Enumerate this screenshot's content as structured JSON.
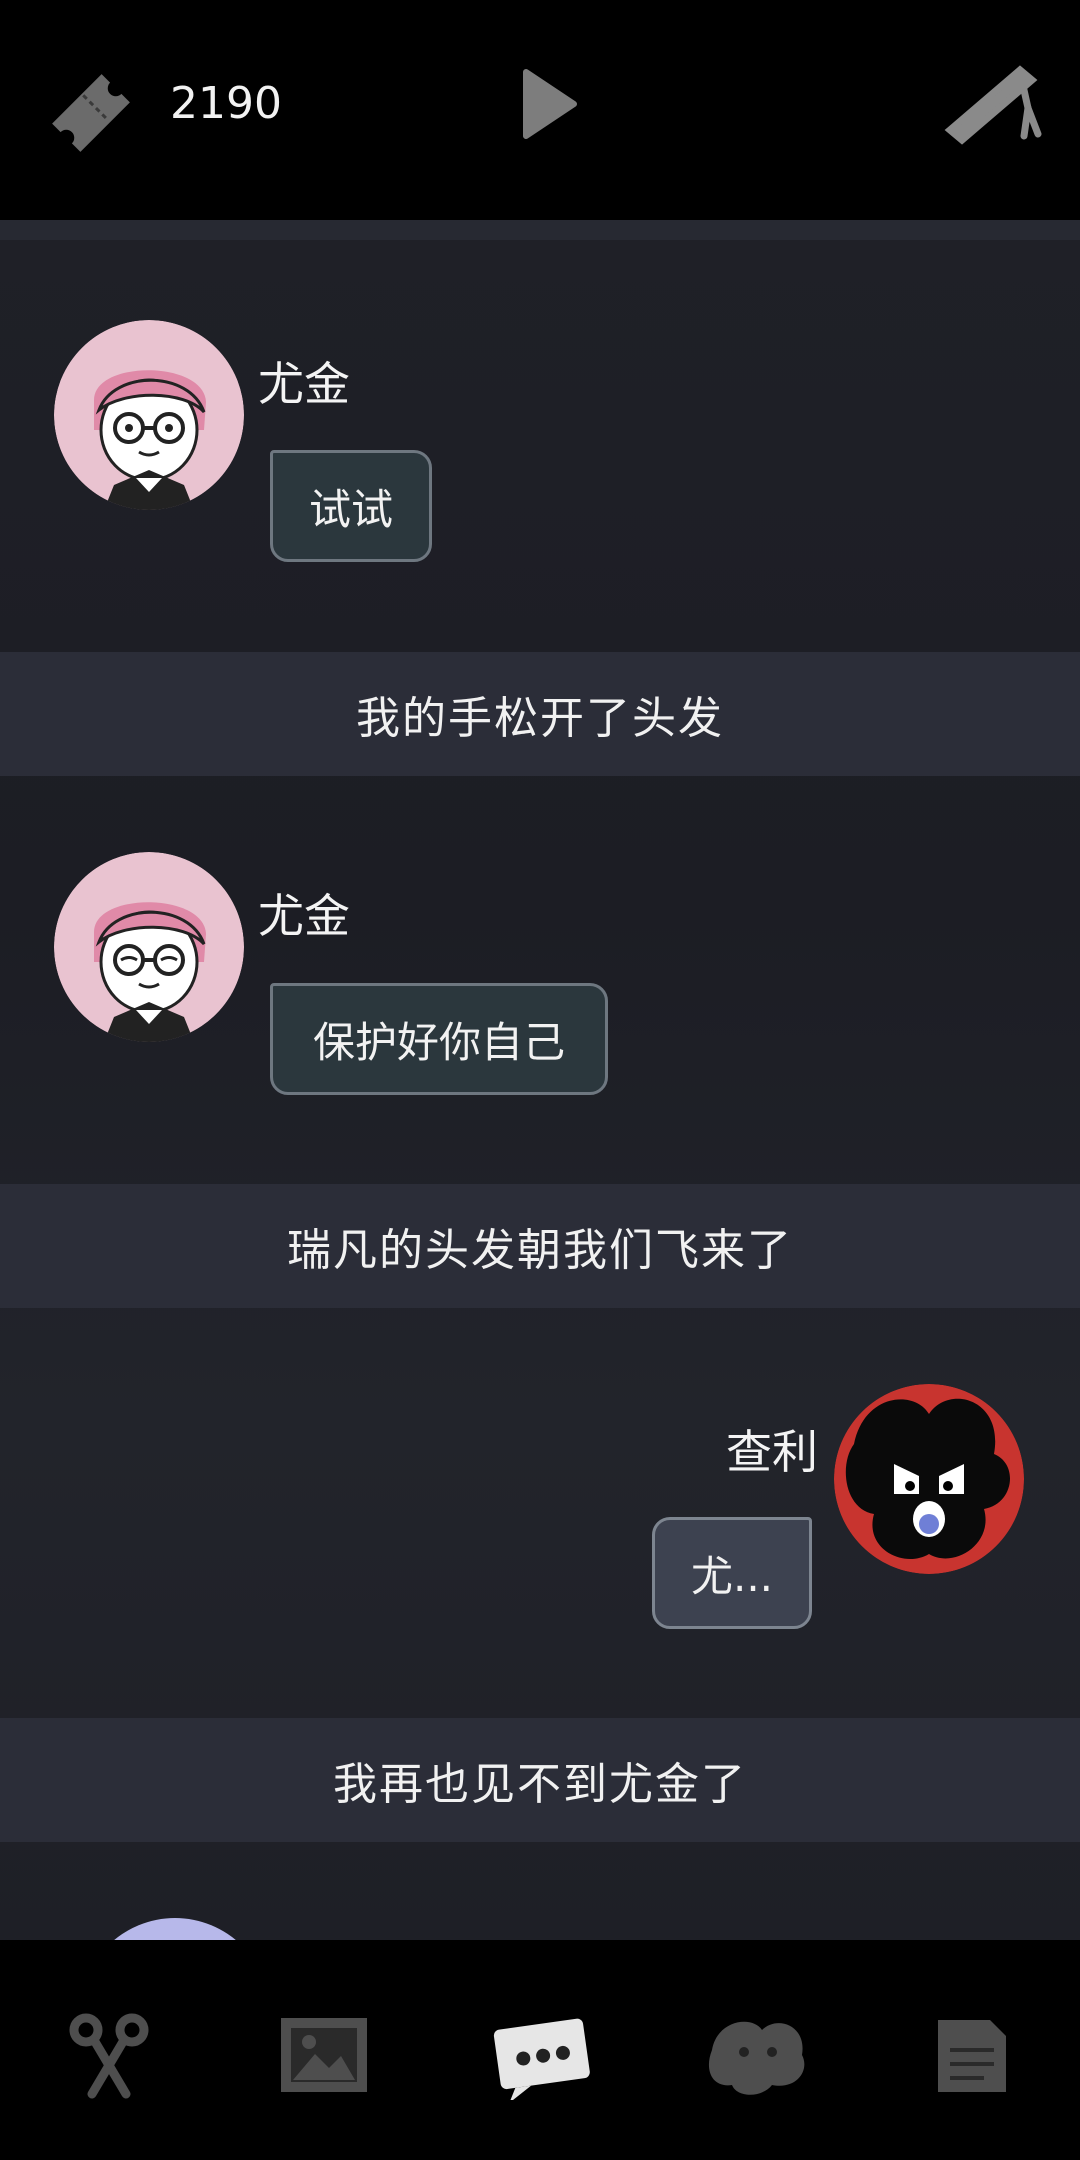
{
  "header": {
    "ticket_icon": "ticket-icon",
    "ticket_count": "2190",
    "play_icon": "play-icon",
    "edit_icon": "pen-icon"
  },
  "messages": [
    {
      "type": "chat",
      "speaker": "尤金",
      "side": "left",
      "text": "试试",
      "avatar": "eugene-avatar"
    },
    {
      "type": "narration",
      "text": "我的手松开了头发"
    },
    {
      "type": "chat",
      "speaker": "尤金",
      "side": "left",
      "text": "保护好你自己",
      "avatar": "eugene-avatar-eyes-closed"
    },
    {
      "type": "narration",
      "text": "瑞凡的头发朝我们飞来了"
    },
    {
      "type": "chat",
      "speaker": "查利",
      "side": "right",
      "text": "尤...",
      "avatar": "charlie-avatar"
    },
    {
      "type": "narration",
      "text": "我再也见不到尤金了"
    }
  ],
  "bottom_nav": [
    {
      "icon": "scissors-icon",
      "active": false
    },
    {
      "icon": "photo-icon",
      "active": false
    },
    {
      "icon": "chat-icon",
      "active": true
    },
    {
      "icon": "creature-icon",
      "active": false
    },
    {
      "icon": "note-icon",
      "active": false
    }
  ],
  "colors": {
    "background": "#1e1f26",
    "narration_bar": "#2b2d38",
    "bubble_left": "#2b373d",
    "bubble_right": "#3d4250",
    "avatar_ring_pink": "#e9c3d0",
    "avatar_ring_red": "#c8342f"
  }
}
